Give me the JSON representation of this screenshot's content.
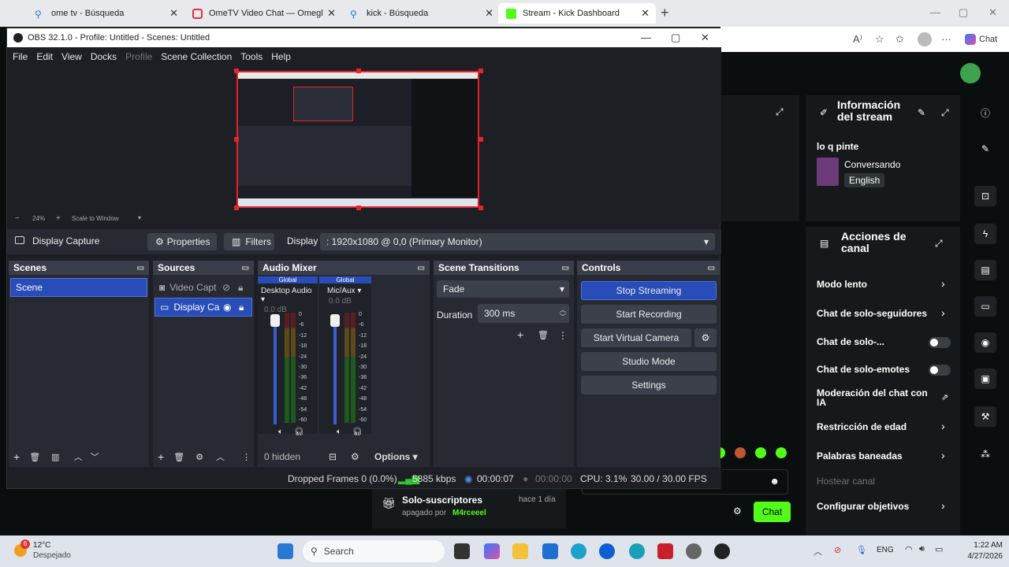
{
  "browser": {
    "tabs": [
      {
        "title": "ome tv - Búsqueda",
        "icon": "search-icon"
      },
      {
        "title": "OmeTV Video Chat — Omegl",
        "icon": "ometv-icon"
      },
      {
        "title": "kick - Búsqueda",
        "icon": "search-icon"
      },
      {
        "title": "Stream - Kick Dashboard",
        "icon": "kick-icon"
      }
    ],
    "new_tab": "+",
    "chat_label": "Chat"
  },
  "obs": {
    "title": "OBS 32.1.0 - Profile: Untitled - Scenes: Untitled",
    "menu": [
      "File",
      "Edit",
      "View",
      "Docks",
      "Profile",
      "Scene Collection",
      "Tools",
      "Help"
    ],
    "zoom": "24%",
    "scale_mode": "Scale to Window",
    "source_bar": {
      "selected_source": "Display Capture",
      "properties": "Properties",
      "filters": "Filters",
      "display_label": "Display",
      "display_value": ": 1920x1080 @ 0,0 (Primary Monitor)"
    },
    "scenes": {
      "title": "Scenes",
      "items": [
        "Scene"
      ]
    },
    "sources": {
      "title": "Sources",
      "items": [
        "Video Capt",
        "Display Ca"
      ]
    },
    "mixer": {
      "title": "Audio Mixer",
      "channels": [
        {
          "tag": "Global",
          "name": "Desktop Audio",
          "db": "0.0 dB"
        },
        {
          "tag": "Global",
          "name": "Mic/Aux",
          "db": "0.0 dB"
        }
      ],
      "scale": [
        "0",
        "-6",
        "-12",
        "-18",
        "-24",
        "-30",
        "-36",
        "-42",
        "-48",
        "-54",
        "-60"
      ],
      "hidden": "0 hidden",
      "options": "Options"
    },
    "transitions": {
      "title": "Scene Transitions",
      "type": "Fade",
      "duration_label": "Duration",
      "duration": "300 ms"
    },
    "controls": {
      "title": "Controls",
      "stop_streaming": "Stop Streaming",
      "start_recording": "Start Recording",
      "start_virtual_camera": "Start Virtual Camera",
      "studio_mode": "Studio Mode",
      "settings": "Settings"
    },
    "status": {
      "dropped": "Dropped Frames 0 (0.0%)",
      "bitrate": "5885 kbps",
      "stream_time": "00:00:07",
      "rec_time": "00:00:00",
      "cpu": "CPU: 3.1%",
      "fps": "30.00 / 30.00 FPS"
    }
  },
  "kick": {
    "stream_info_title_1": "Información",
    "stream_info_title_2": "del stream",
    "stream_title": "lo q pinte",
    "category": "Conversando",
    "language": "English",
    "actions_title_1": "Acciones de",
    "actions_title_2": "canal",
    "actions": [
      {
        "label": "Modo lento",
        "kind": "chevron"
      },
      {
        "label": "Chat de solo-seguidores",
        "kind": "chevron"
      },
      {
        "label": "Chat de solo-...",
        "kind": "toggle"
      },
      {
        "label": "Chat de solo-emotes",
        "kind": "toggle"
      },
      {
        "label": "Moderación del chat con",
        "label2": "IA",
        "kind": "link"
      },
      {
        "label": "Restricción de edad",
        "kind": "chevron"
      },
      {
        "label": "Palabras baneadas",
        "kind": "chevron"
      },
      {
        "label": "Hostear canal",
        "kind": "disabled"
      },
      {
        "label": "Configurar objetivos",
        "kind": "chevron"
      }
    ],
    "sub_only": "Solo-suscriptores",
    "sub_status": "apagado por",
    "sub_user": "M4rceeel",
    "sub_time": "hace 1 día",
    "chat_button": "Chat",
    "accent": "#53fc18"
  },
  "taskbar": {
    "weather_temp": "12°C",
    "weather_desc": "Despejado",
    "weather_badge": "6",
    "search": "Search",
    "lang": "ENG",
    "time": "1:22 AM",
    "date": "4/27/2026"
  }
}
